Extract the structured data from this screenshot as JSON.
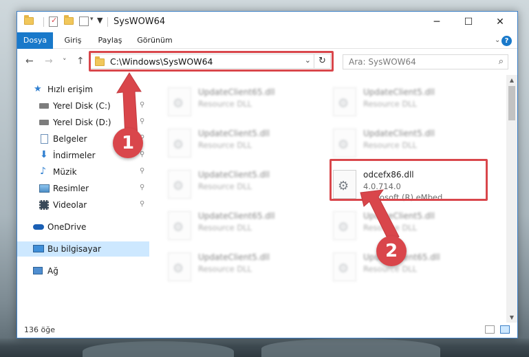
{
  "window": {
    "title": "SysWOW64",
    "controls": {
      "minimize": "─",
      "maximize": "☐",
      "close": "✕"
    }
  },
  "ribbon": {
    "tabs": [
      "Dosya",
      "Giriş",
      "Paylaş",
      "Görünüm"
    ],
    "active_tab": "Dosya",
    "help": "?"
  },
  "address": {
    "path": "C:\\Windows\\SysWOW64",
    "dropdown": "⌄",
    "refresh": "↻"
  },
  "search": {
    "placeholder": "Ara: SysWOW64",
    "icon": "search-icon"
  },
  "nav_buttons": {
    "back": "←",
    "forward": "→",
    "recent": "˅",
    "up": "↑"
  },
  "sidebar": {
    "items": [
      {
        "label": "Hızlı erişim",
        "icon": "star-icon"
      },
      {
        "label": "Yerel Disk (C:)",
        "icon": "drive-icon",
        "pinned": true
      },
      {
        "label": "Yerel Disk (D:)",
        "icon": "drive-icon",
        "pinned": true
      },
      {
        "label": "Belgeler",
        "icon": "documents-icon",
        "pinned": true
      },
      {
        "label": "İndirmeler",
        "icon": "downloads-icon",
        "pinned": true
      },
      {
        "label": "Müzik",
        "icon": "music-icon",
        "pinned": true
      },
      {
        "label": "Resimler",
        "icon": "pictures-icon",
        "pinned": true
      },
      {
        "label": "Videolar",
        "icon": "videos-icon",
        "pinned": true
      },
      {
        "label": "OneDrive",
        "icon": "cloud-icon"
      },
      {
        "label": "Bu bilgisayar",
        "icon": "computer-icon",
        "selected": true
      },
      {
        "label": "Ağ",
        "icon": "network-icon"
      }
    ],
    "pin_glyph": "📌"
  },
  "files": [
    {
      "name": "UpdateClient65.dll",
      "line2": "Resource DLL",
      "line3": ""
    },
    {
      "name": "UpdateClient5.dll",
      "line2": "Resource DLL",
      "line3": ""
    },
    {
      "name": "UpdateClient5.dll",
      "line2": "Resource DLL",
      "line3": ""
    },
    {
      "name": "UpdateClient5.dll",
      "line2": "Resource DLL",
      "line3": ""
    },
    {
      "name": "UpdateClient5.dll",
      "line2": "Resource DLL",
      "line3": ""
    },
    {
      "name": "odcefx86.dll",
      "line2": "4.0.714.0",
      "line3": "Microsoft (R) eMbed...",
      "highlighted": true
    },
    {
      "name": "UpdateClient65.dll",
      "line2": "Resource DLL",
      "line3": ""
    },
    {
      "name": "UpdateClient5.dll",
      "line2": "Resource DLL",
      "line3": ""
    },
    {
      "name": "UpdateClient5.dll",
      "line2": "Resource DLL",
      "line3": ""
    },
    {
      "name": "UpdateClient65.dll",
      "line2": "Resource DLL",
      "line3": ""
    }
  ],
  "status": {
    "item_count": "136 öğe"
  },
  "callouts": {
    "one": "1",
    "two": "2"
  },
  "colors": {
    "accent": "#1979ca",
    "highlight": "#d9464b",
    "selected_bg": "#cde8ff"
  }
}
